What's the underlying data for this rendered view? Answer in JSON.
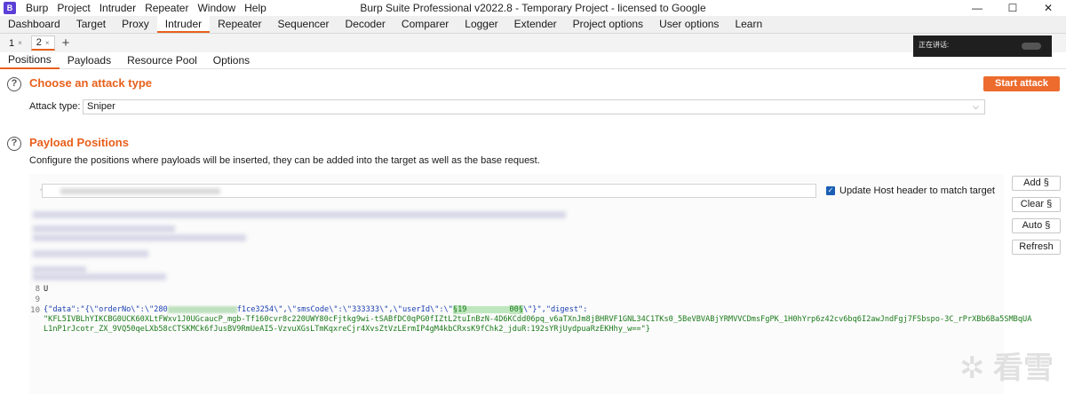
{
  "titlebar": {
    "logo": "B",
    "menu": [
      "Burp",
      "Project",
      "Intruder",
      "Repeater",
      "Window",
      "Help"
    ],
    "title": "Burp Suite Professional v2022.8 - Temporary Project - licensed to Google",
    "controls": {
      "minimize": "—",
      "maximize": "☐",
      "close": "✕"
    }
  },
  "main_tabs": [
    "Dashboard",
    "Target",
    "Proxy",
    "Intruder",
    "Repeater",
    "Sequencer",
    "Decoder",
    "Comparer",
    "Logger",
    "Extender",
    "Project options",
    "User options",
    "Learn"
  ],
  "active_main_tab": "Intruder",
  "attack_tabs": [
    {
      "label": "1",
      "close": "×"
    },
    {
      "label": "2",
      "close": "×"
    }
  ],
  "add_tab": "+",
  "overlay_text": "正在讲话:",
  "intruder_tabs": [
    "Positions",
    "Payloads",
    "Resource Pool",
    "Options"
  ],
  "attack_type_section": {
    "help": "?",
    "title": "Choose an attack type",
    "start_button": "Start attack",
    "label": "Attack type:",
    "selected": "Sniper",
    "chevron": "⌵"
  },
  "payload_positions": {
    "help": "?",
    "title": "Payload Positions",
    "description": "Configure the positions where payloads will be inserted, they can be added into the target as well as the base request.",
    "target_icon": "◠",
    "update_host_checked": "✓",
    "update_host_label": "Update Host header to match target",
    "buttons": {
      "add": "Add §",
      "clear": "Clear §",
      "auto": "Auto §",
      "refresh": "Refresh"
    },
    "line_numbers": {
      "l8": "8",
      "l9": "9",
      "l10": "10"
    },
    "line8_prefix": "U",
    "line10a_pre": "{\"data\":\"{\\\"orderNo\\\":\\\"280",
    "line10a_mid": "f1ce3254",
    "line10a_post": "\\\",\\\"smsCode\\\":\\\"333333\\\",\\\"userId\\\":\\\"",
    "line10a_payload": "§19",
    "line10a_payload_end": "00§",
    "line10a_tail": "\\\"}\",\"digest\":",
    "line10b": "\"KFL5IVBLhYIKCBG0UCK60XLtFWxv1J0UGcaucP_mgb-Tf160cvr8c220UWY80cFjtkg9wi-tSABfDC0qPG0fIZtL2tuInBzN-4D6KCdd06pq_v6aTXnJm8jBHRVF1GNL34C1TKs0_5BeVBVABjYRMVVCDmsFgPK_1H0hYrp6z42cv6bq6I2awJndFgj7FSbspo-3C_rPrXBb6Ba5SMBqUA",
    "line10c": "L1nP1rJcotr_ZX_9VQ50qeLXb58cCTSKMCk6fJusBV9RmUeAI5-VzvuXGsLTmKqxreCjr4XvsZtVzLErmIP4gM4kbCRxsK9fChk2_jduR:192sYRjUydpuaRzEKHhy_w==\"}"
  },
  "watermark": "✲ 看雪"
}
